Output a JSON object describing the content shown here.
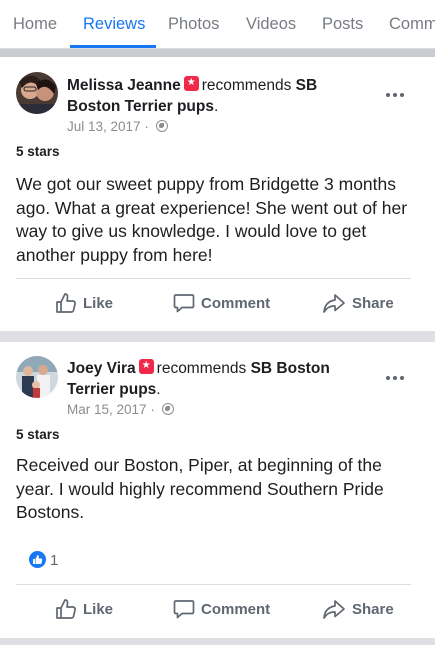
{
  "tabs": [
    {
      "label": "Home",
      "active": false
    },
    {
      "label": "Reviews",
      "active": true
    },
    {
      "label": "Photos",
      "active": false
    },
    {
      "label": "Videos",
      "active": false
    },
    {
      "label": "Posts",
      "active": false
    },
    {
      "label": "Comm",
      "active": false
    }
  ],
  "reviews": [
    {
      "reviewer": "Melissa Jeanne",
      "verb": "recommends",
      "page_line1": "SB",
      "page_line2": "Boston Terrier pups",
      "date": "Jul 13, 2017",
      "stars": "5 stars",
      "text": "We got our sweet puppy from Bridgette 3 months ago. What a great experience! She went out of her way to give us knowledge. I would love to get another puppy from here!",
      "likes": null
    },
    {
      "reviewer": "Joey Vira",
      "verb": "recommends",
      "page_line1": "SB Boston",
      "page_line2": "Terrier pups",
      "date": "Mar 15, 2017",
      "stars": "5 stars",
      "text": "Received our Boston, Piper, at beginning of the year.  I would highly recommend Southern Pride Bostons.",
      "likes": "1"
    }
  ],
  "actions": {
    "like": "Like",
    "comment": "Comment",
    "share": "Share"
  },
  "colors": {
    "accent": "#1877f2",
    "recommend_badge": "#f02849",
    "text_secondary": "#606770"
  }
}
